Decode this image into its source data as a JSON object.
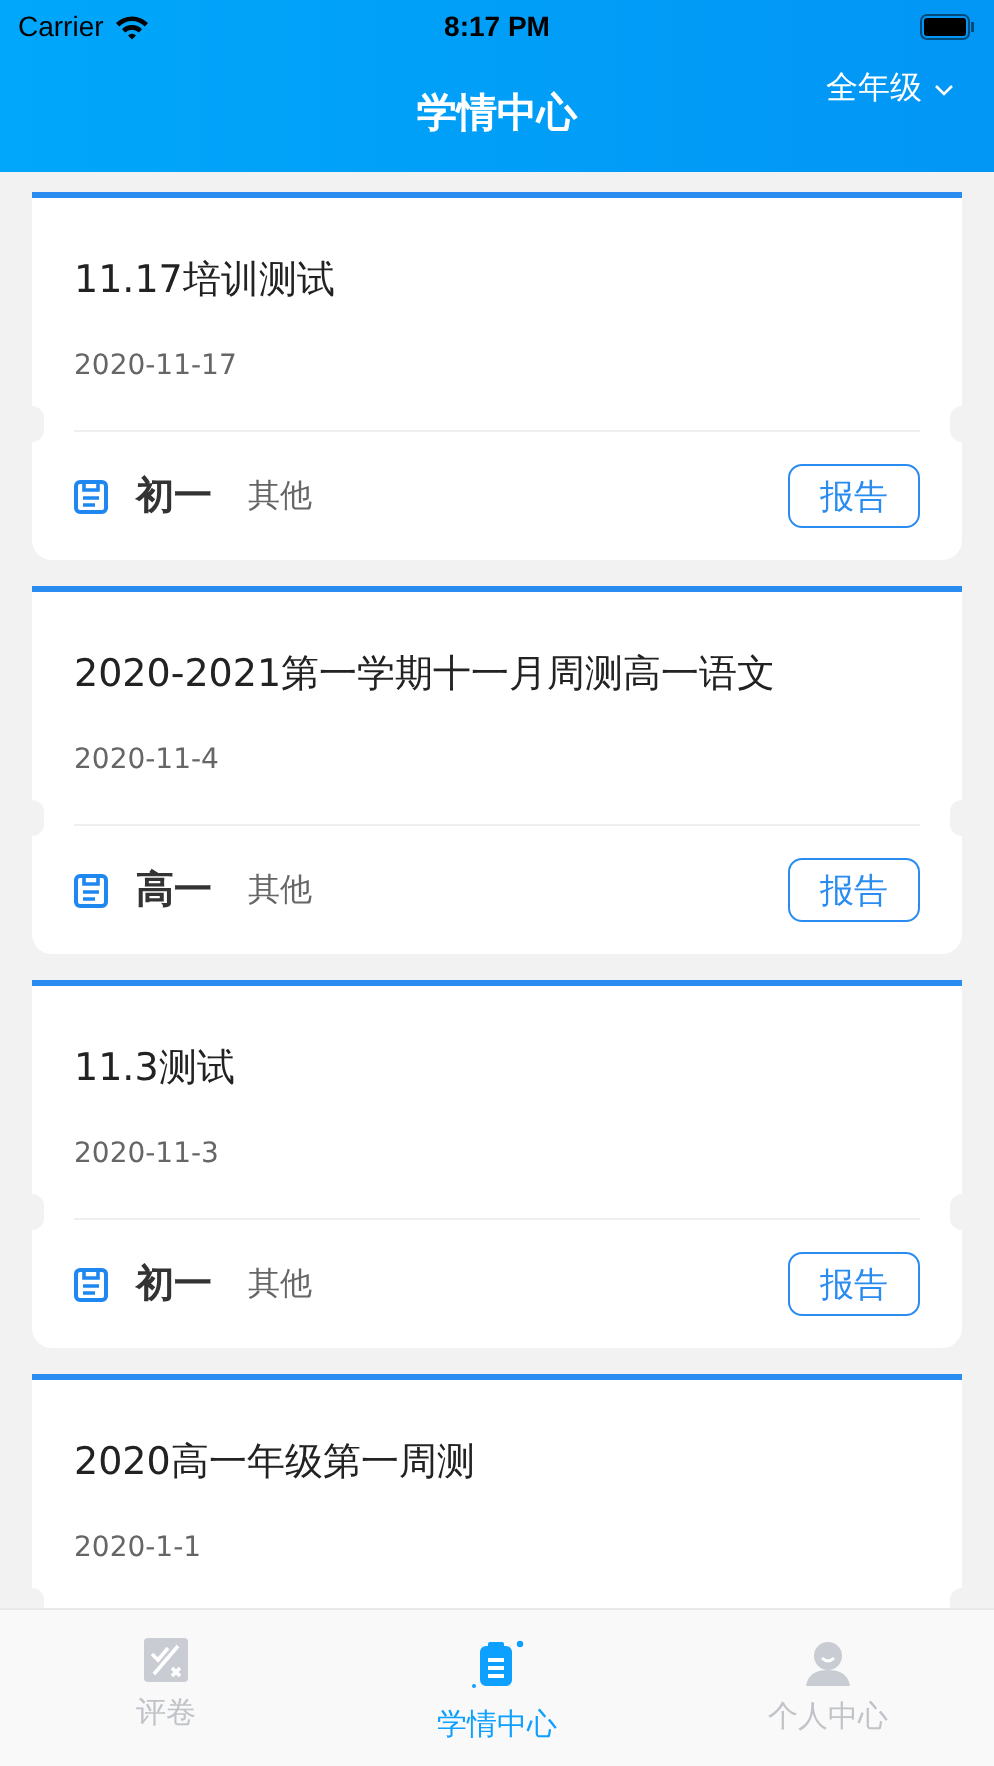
{
  "status_bar": {
    "carrier": "Carrier",
    "time": "8:17 PM"
  },
  "header": {
    "title": "学情中心",
    "filter": "全年级"
  },
  "cards": [
    {
      "title": "11.17培训测试",
      "date": "2020-11-17",
      "grade": "初一",
      "subject": "其他",
      "action": "报告"
    },
    {
      "title": "2020-2021第一学期十一月周测高一语文",
      "date": "2020-11-4",
      "grade": "高一",
      "subject": "其他",
      "action": "报告"
    },
    {
      "title": "11.3测试",
      "date": "2020-11-3",
      "grade": "初一",
      "subject": "其他",
      "action": "报告"
    },
    {
      "title": "2020高一年级第一周测",
      "date": "2020-1-1"
    }
  ],
  "tabs": [
    {
      "label": "评卷",
      "kind": "grading",
      "selected": false
    },
    {
      "label": "学情中心",
      "kind": "report",
      "selected": true
    },
    {
      "label": "个人中心",
      "kind": "profile",
      "selected": false
    }
  ]
}
